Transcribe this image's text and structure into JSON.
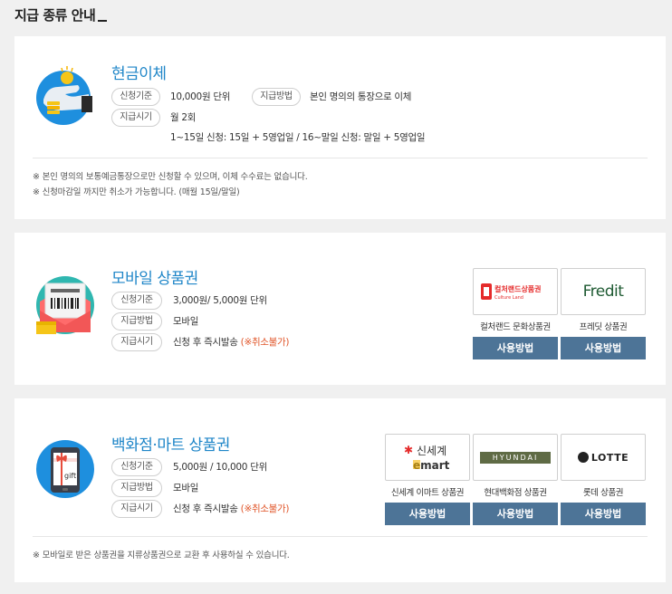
{
  "page": {
    "title": "지급 종류 안내"
  },
  "cash": {
    "title": "현금이체",
    "label_criteria": "신청기준",
    "value_criteria": "10,000원 단위",
    "label_method": "지급방법",
    "value_method": "본인 명의의 통장으로 이체",
    "label_time": "지급시기",
    "value_time": "월 2회",
    "value_time_detail": "1~15일 신청: 15일 + 5영업일 / 16~말일 신청: 말일 + 5영업일",
    "notes": [
      "※ 본인 명의의 보통예금통장으로만 신청할 수 있으며, 이체 수수료는 없습니다.",
      "※ 신청마감일 까지만 취소가 가능합니다. (매월 15일/말일)"
    ]
  },
  "mobile": {
    "title": "모바일 상품권",
    "label_criteria": "신청기준",
    "value_criteria": "3,000원/ 5,000원 단위",
    "label_method": "지급방법",
    "value_method": "모바일",
    "label_time": "지급시기",
    "value_time": "신청 후 즉시발송",
    "value_time_note": "(※취소불가)",
    "vouchers": [
      {
        "logo": "컬처랜드상품권",
        "logo_sub": "Culture Land",
        "name": "컬처랜드 문화상품권",
        "button": "사용방법"
      },
      {
        "logo": "Fredit",
        "name": "프레딧 상품권",
        "button": "사용방법"
      }
    ]
  },
  "dept": {
    "title": "백화점·마트 상품권",
    "label_criteria": "신청기준",
    "value_criteria": "5,000원 / 10,000 단위",
    "label_method": "지급방법",
    "value_method": "모바일",
    "label_time": "지급시기",
    "value_time": "신청 후 즉시발송",
    "value_time_note": "(※취소불가)",
    "vouchers": [
      {
        "logo": "신세계",
        "logo_sub": "emart",
        "name": "신세계 이마트 상품권",
        "button": "사용방법"
      },
      {
        "logo": "HYUNDAI",
        "name": "현대백화점 상품권",
        "button": "사용방법"
      },
      {
        "logo": "LOTTE",
        "name": "롯데 상품권",
        "button": "사용방법"
      }
    ],
    "notes": [
      "※ 모바일로 받은 상품권을 지류상품권으로 교환 후 사용하실 수 있습니다."
    ],
    "illus_text": "gift"
  },
  "colors": {
    "accent": "#1f86c8",
    "button": "#4d7497",
    "warning": "#e0562a"
  }
}
